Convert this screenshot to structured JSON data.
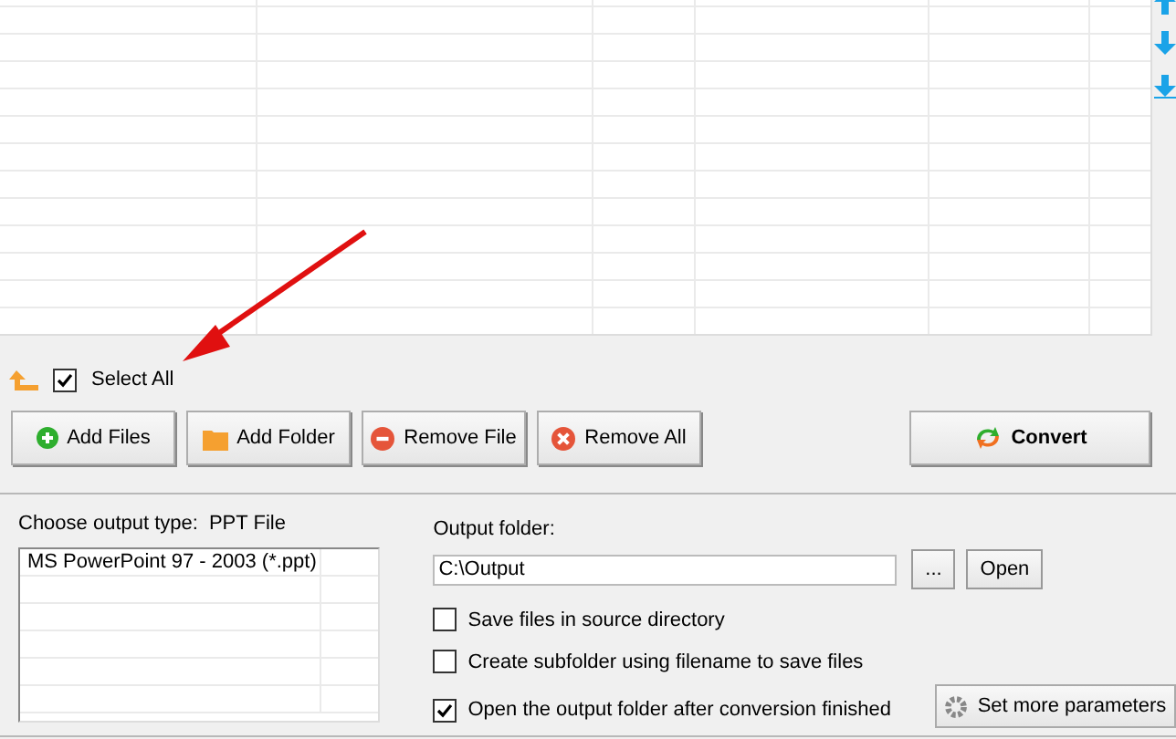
{
  "select_all": {
    "label": "Select All",
    "checked": true
  },
  "buttons": [
    {
      "label": "Add Files",
      "kind": "add"
    },
    {
      "label": "Add Folder",
      "kind": "folder"
    },
    {
      "label": "Remove File",
      "kind": "remove"
    },
    {
      "label": "Remove All",
      "kind": "clear"
    }
  ],
  "convert_button": {
    "label": "Convert"
  },
  "output_type": {
    "label": "Choose output type:",
    "value": "PPT File",
    "items": [
      {
        "label": "MS PowerPoint 97 - 2003 (*.ppt)",
        "selected": false
      }
    ]
  },
  "output_folder": {
    "label": "Output folder:",
    "value": "C:\\Output",
    "browse": "...",
    "open": "Open"
  },
  "options": [
    {
      "label": "Save files in source directory",
      "checked": false
    },
    {
      "label": "Create subfolder using filename to save files",
      "checked": false
    },
    {
      "label": "Open the output folder after conversion finished",
      "checked": true
    }
  ],
  "more_button": {
    "label": "Set more parameters"
  }
}
